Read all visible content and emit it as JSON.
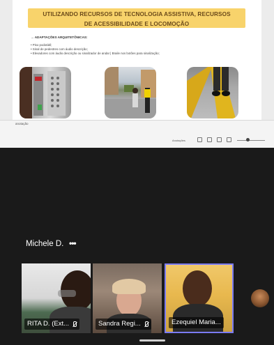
{
  "slide": {
    "title_line1": "UTILIZANDO RECURSOS DE TECNOLOGIA ASSISTIVA, RECURSOS",
    "title_line2": "DE ACESSIBILIDADE E LOCOMOÇÃO",
    "subheading": "→ ADAPTAÇÕES ARQUITETÔNICAS:",
    "bullets": [
      "Piso podotátil;",
      "Sinal de pedestres com áudio descrição;",
      "Elevadores com áudio descrição ou sinalizador de andar | Braile nos botões para sinalização;"
    ],
    "photos": [
      "elevator-photo",
      "crosswalk-photo",
      "tactile-floor-photo"
    ]
  },
  "share_bar": {
    "caption": "anotação",
    "notes_label": "Anotações"
  },
  "participants": {
    "active_speaker": "Michele D.",
    "more_label": "•••",
    "tiles": [
      {
        "name": "RITA D. (Ext...",
        "muted": true
      },
      {
        "name": "Sandra Regi...",
        "muted": true
      },
      {
        "name": "Ezequiel Maria...",
        "muted": false,
        "active": true
      }
    ]
  },
  "colors": {
    "banner": "#f8d36b",
    "active_border": "#7b7bf2",
    "background": "#1a1a1a"
  }
}
